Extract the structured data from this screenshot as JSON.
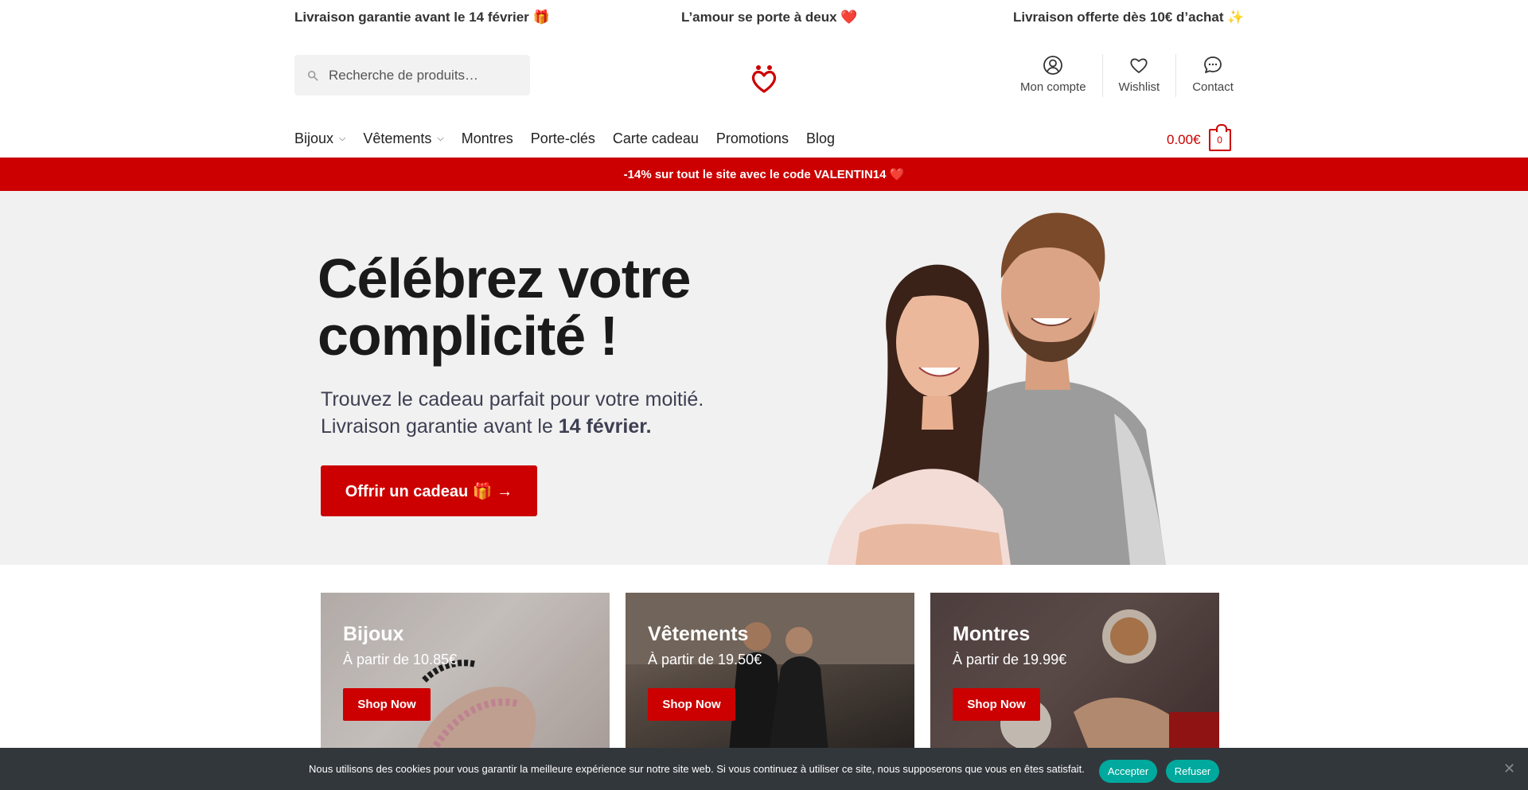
{
  "topbar": {
    "left": "Livraison garantie avant le 14 février 🎁",
    "center": "L’amour se porte à deux ❤️",
    "right": "Livraison offerte dès 10€ d’achat ✨"
  },
  "search": {
    "placeholder": "Recherche de produits…"
  },
  "header_links": [
    {
      "label": "Mon compte",
      "icon": "user-icon"
    },
    {
      "label": "Wishlist",
      "icon": "heart-icon"
    },
    {
      "label": "Contact",
      "icon": "chat-icon"
    }
  ],
  "nav": [
    {
      "label": "Bijoux",
      "dropdown": true
    },
    {
      "label": "Vêtements",
      "dropdown": true
    },
    {
      "label": "Montres",
      "dropdown": false
    },
    {
      "label": "Porte-clés",
      "dropdown": false
    },
    {
      "label": "Carte cadeau",
      "dropdown": false
    },
    {
      "label": "Promotions",
      "dropdown": false
    },
    {
      "label": "Blog",
      "dropdown": false
    }
  ],
  "cart": {
    "total": "0.00€",
    "count": "0"
  },
  "promo": "-14% sur tout le site avec le code VALENTIN14 ❤️",
  "hero": {
    "title": "Célébrez votre complicité !",
    "sub_line1": "Trouvez le cadeau parfait pour votre moitié.",
    "sub_line2_prefix": "Livraison garantie avant le ",
    "sub_line2_bold": "14 février.",
    "cta": "Offrir un cadeau 🎁 →"
  },
  "tiles": [
    {
      "title": "Bijoux",
      "price": "À partir de 10.85€",
      "button": "Shop Now"
    },
    {
      "title": "Vêtements",
      "price": "À partir de 19.50€",
      "button": "Shop Now"
    },
    {
      "title": "Montres",
      "price": "À partir de 19.99€",
      "button": "Shop Now"
    }
  ],
  "cookie": {
    "text": "Nous utilisons des cookies pour vous garantir la meilleure expérience sur notre site web. Si vous continuez à utiliser ce site, nous supposerons que vous en êtes satisfait.",
    "accept": "Accepter",
    "refuse": "Refuser",
    "close": "✕"
  },
  "colors": {
    "accent": "#cc0000",
    "cookie_bg": "#32373c",
    "cookie_btn": "#00a99d",
    "hero_bg": "#f1f1f1"
  }
}
